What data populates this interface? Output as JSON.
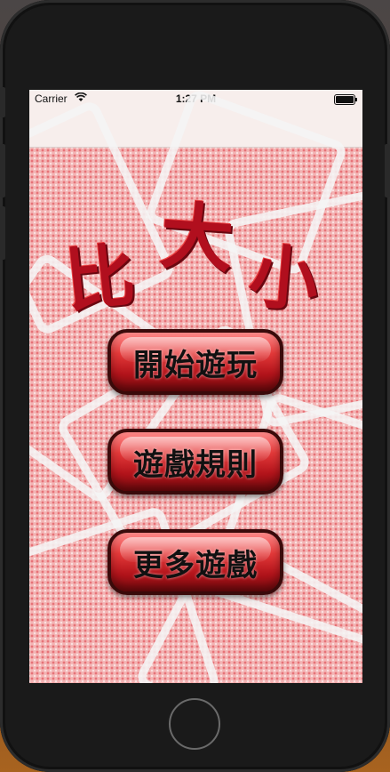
{
  "status_bar": {
    "carrier": "Carrier",
    "time": "1:27 PM",
    "wifi_icon": "wifi-icon",
    "battery_icon": "battery-icon"
  },
  "title": {
    "char1": "比",
    "char2": "大",
    "char3": "小"
  },
  "menu": {
    "start_label": "開始遊玩",
    "rules_label": "遊戲規則",
    "more_label": "更多遊戲"
  },
  "colors": {
    "title": "#b10f1e",
    "button_red": "#e53a3a",
    "background_pink": "#f3b4b4"
  }
}
